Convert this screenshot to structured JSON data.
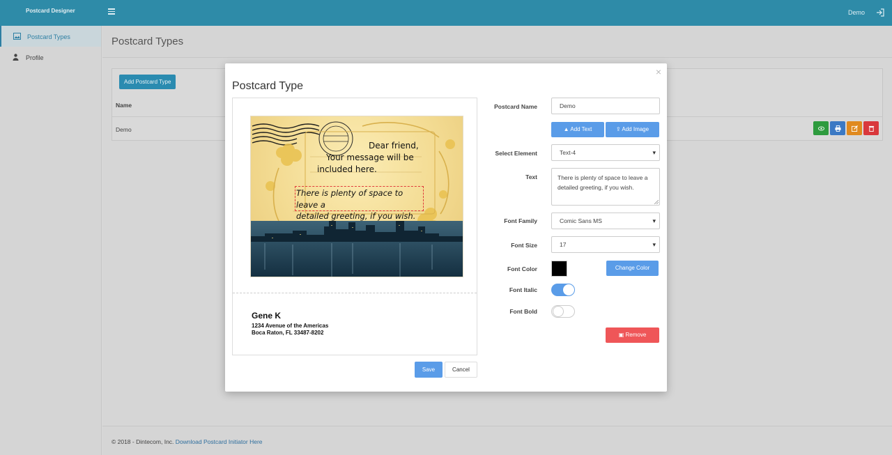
{
  "app": {
    "brand": "Postcard Designer",
    "user": "Demo"
  },
  "sidebar": {
    "items": [
      {
        "label": "Postcard Types",
        "icon": "image-icon",
        "active": true
      },
      {
        "label": "Profile",
        "icon": "user-icon",
        "active": false
      }
    ]
  },
  "page": {
    "title": "Postcard Types"
  },
  "panel": {
    "add_button": "Add Postcard Type",
    "column_name": "Name",
    "rows": [
      {
        "name": "Demo"
      }
    ],
    "action_colors": {
      "view": "#2e9b3e",
      "print": "#3b79c4",
      "edit": "#e08a1f",
      "delete": "#d9383c"
    }
  },
  "footer": {
    "copyright": "© 2018 - Dintecom, Inc.",
    "link": "Download Postcard Initiator Here"
  },
  "modal": {
    "title": "Postcard Type",
    "card": {
      "text1_line1": "Dear friend,",
      "text1_line2": "Your message will be",
      "text1_line3": "included here.",
      "text2_line1": "There is plenty of space to leave a",
      "text2_line2": "detailed greeting, if you wish.",
      "address_name": "Gene K",
      "address_line1": "1234 Avenue of the Americas",
      "address_line2": "Boca Raton, FL 33487-8202"
    },
    "save": "Save",
    "cancel": "Cancel",
    "form": {
      "name_label": "Postcard Name",
      "name_value": "Demo",
      "add_text": "Add Text",
      "add_image": "Add Image",
      "select_element_label": "Select Element",
      "select_element_value": "Text-4",
      "text_label": "Text",
      "text_value": "There is plenty of space to leave a detailed greeting, if you wish.",
      "font_family_label": "Font Family",
      "font_family_value": "Comic Sans MS",
      "font_size_label": "Font Size",
      "font_size_value": "17",
      "font_color_label": "Font Color",
      "font_color_value": "#000000",
      "change_color": "Change Color",
      "font_italic_label": "Font Italic",
      "font_italic_on": true,
      "font_bold_label": "Font Bold",
      "font_bold_on": false,
      "remove": "Remove"
    }
  }
}
